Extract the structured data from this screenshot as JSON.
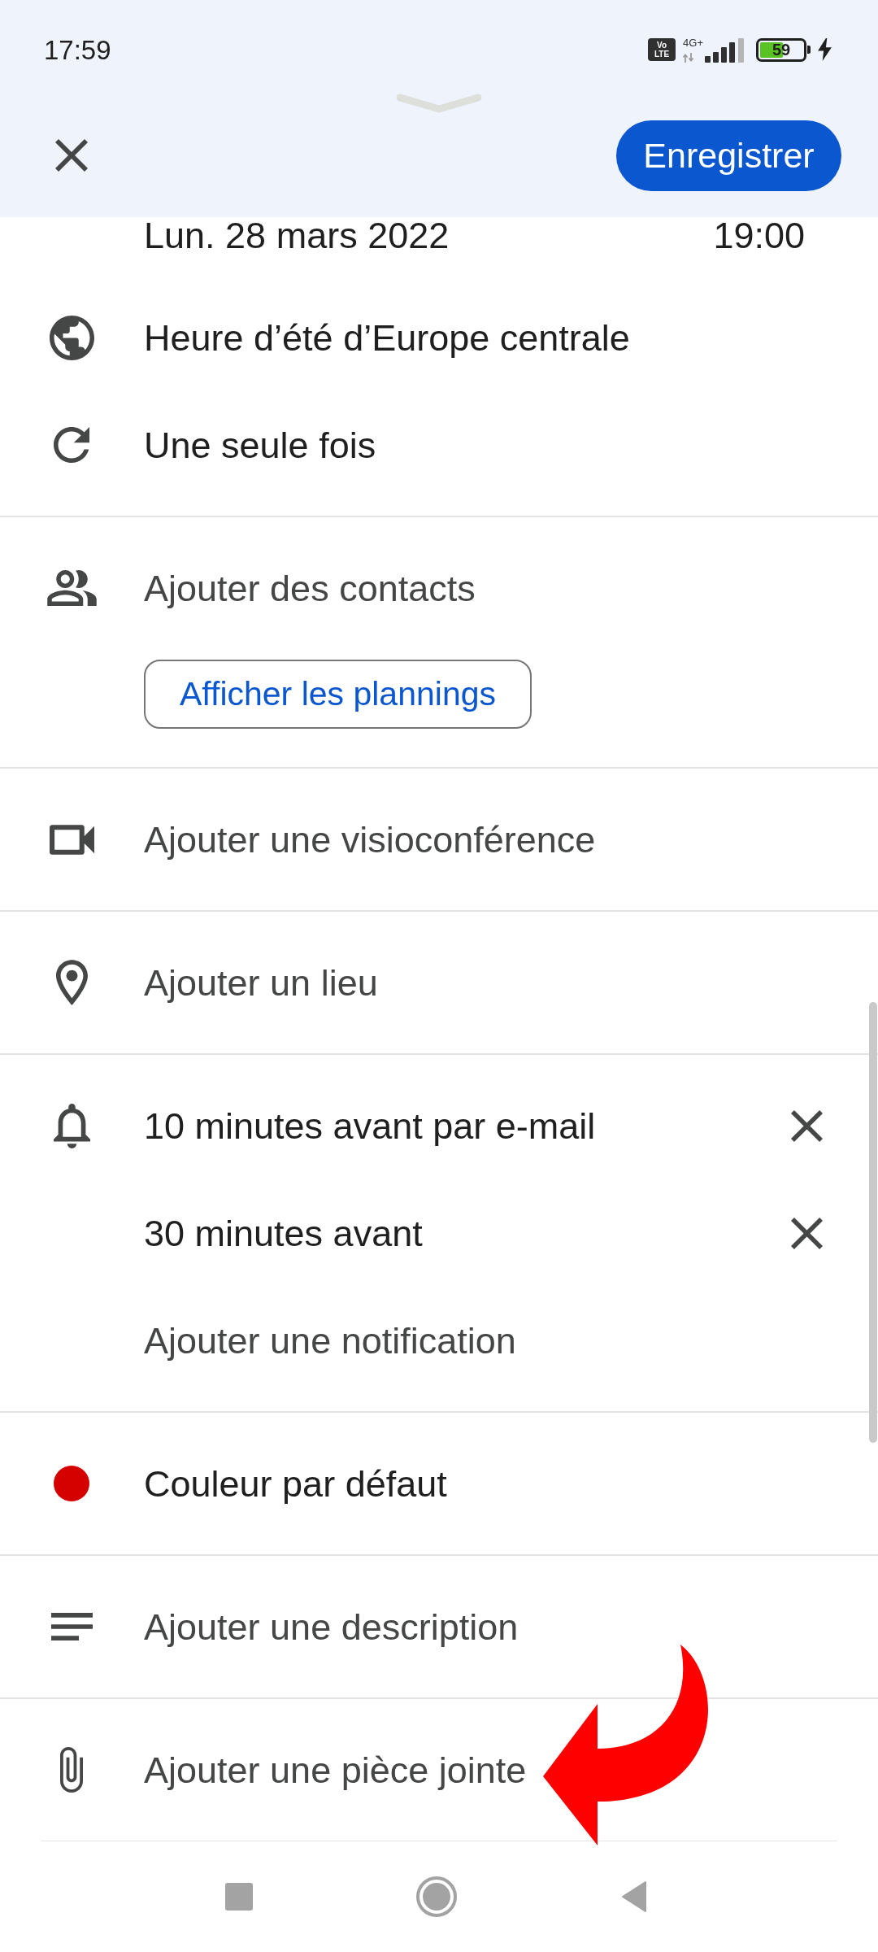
{
  "status_bar": {
    "time": "17:59",
    "volte": [
      "Vo",
      "LTE"
    ],
    "network": "4G+",
    "battery": "59",
    "charging": true
  },
  "header": {
    "save_button": "Enregistrer"
  },
  "sections": [
    {
      "rows": [
        {
          "kind": "date_time",
          "date": "Lun. 28 mars 2022",
          "time": "19:00",
          "hint": false
        },
        {
          "kind": "time_zone",
          "text": "Heure d’été d’Europe centrale",
          "hint": false
        },
        {
          "kind": "repeat",
          "text": "Une seule fois",
          "hint": false
        }
      ]
    },
    {
      "rows": [
        {
          "kind": "guests",
          "text": "Ajouter des contacts",
          "hint": true
        },
        {
          "kind": "outlined_button",
          "text": "Afficher les plannings"
        }
      ]
    },
    {
      "rows": [
        {
          "kind": "video_call",
          "text": "Ajouter une visioconférence",
          "hint": true
        }
      ]
    },
    {
      "rows": [
        {
          "kind": "location",
          "text": "Ajouter un lieu",
          "hint": true
        }
      ]
    },
    {
      "rows": [
        {
          "kind": "notification",
          "text": "10 minutes avant par e-mail",
          "hint": false,
          "removable": true
        },
        {
          "kind": "notification",
          "text": "30 minutes avant",
          "hint": false,
          "removable": true
        },
        {
          "kind": "notification",
          "text": "Ajouter une notification",
          "hint": true,
          "removable": false
        }
      ]
    },
    {
      "rows": [
        {
          "kind": "color",
          "text": "Couleur par défaut",
          "hint": false,
          "color": "#d50000"
        }
      ]
    },
    {
      "rows": [
        {
          "kind": "description",
          "text": "Ajouter une description",
          "hint": true
        }
      ]
    },
    {
      "rows": [
        {
          "kind": "attachment",
          "text": "Ajouter une pièce jointe",
          "hint": true
        }
      ]
    }
  ],
  "annotation": {
    "kind": "curved_arrow"
  }
}
